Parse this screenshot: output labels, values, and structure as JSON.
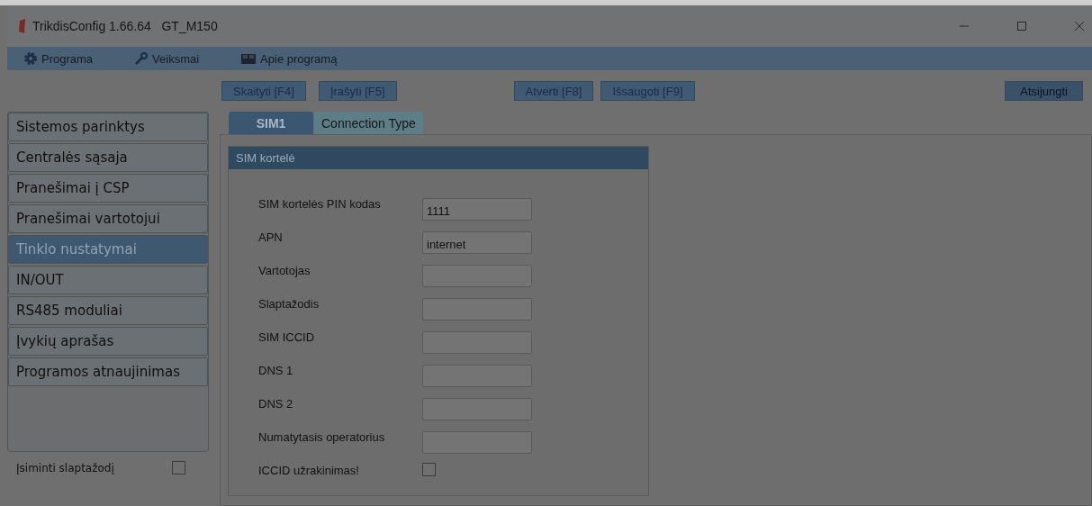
{
  "window": {
    "title": "TrikdisConfig 1.66.64   GT_M150"
  },
  "menu": [
    {
      "label": "Programa"
    },
    {
      "label": "Veiksmai"
    },
    {
      "label": "Apie programą"
    }
  ],
  "toolbar": {
    "device": [
      {
        "label": "Skaityti [F4]"
      },
      {
        "label": "Įrašyti [F5]"
      }
    ],
    "file": [
      {
        "label": "Atverti [F8]"
      },
      {
        "label": "Išsaugoti [F9]"
      }
    ],
    "connection": [
      {
        "label": "Atsijungti"
      }
    ]
  },
  "sidebar": {
    "items": [
      {
        "label": "Sistemos parinktys",
        "selected": false
      },
      {
        "label": "Centralės sąsaja",
        "selected": false
      },
      {
        "label": "Pranešimai į CSP",
        "selected": false
      },
      {
        "label": "Pranešimai vartotojui",
        "selected": false
      },
      {
        "label": "Tinklo nustatymai",
        "selected": true
      },
      {
        "label": "IN/OUT",
        "selected": false
      },
      {
        "label": "RS485 moduliai",
        "selected": false
      },
      {
        "label": "Įvykių aprašas",
        "selected": false
      },
      {
        "label": "Programos atnaujinimas",
        "selected": false
      }
    ],
    "options": [
      {
        "label": "Įsiminti slaptažodį",
        "checked": false
      }
    ]
  },
  "tabs": [
    {
      "label": "SIM1",
      "selected": true
    },
    {
      "label": "Connection Type",
      "selected": false
    }
  ],
  "group": {
    "title": "SIM kortelė",
    "fields": [
      {
        "kind": "text",
        "label": "SIM kortelės PIN kodas",
        "value": "1111"
      },
      {
        "kind": "text",
        "label": "APN",
        "value": "internet"
      },
      {
        "kind": "text",
        "label": "Vartotojas"
      },
      {
        "kind": "text",
        "label": "Slaptažodis"
      },
      {
        "kind": "text",
        "label": "SIM ICCID"
      },
      {
        "kind": "text",
        "label": "DNS 1"
      },
      {
        "kind": "text",
        "label": "DNS 2"
      },
      {
        "kind": "text",
        "label": "Numatytasis operatorius"
      },
      {
        "kind": "checkbox",
        "label": "ICCID užrakinimas!",
        "checked": false
      }
    ]
  }
}
